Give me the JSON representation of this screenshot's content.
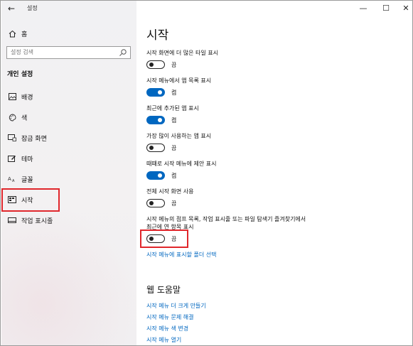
{
  "window": {
    "title": "설정",
    "controls": {
      "minimize": "—",
      "maximize": "☐",
      "close": "✕"
    }
  },
  "sidebar": {
    "home": "홈",
    "search_placeholder": "설정 검색",
    "section": "개인 설정",
    "items": [
      {
        "label": "배경",
        "icon": "image-icon"
      },
      {
        "label": "색",
        "icon": "palette-icon"
      },
      {
        "label": "잠금 화면",
        "icon": "lock-screen-icon"
      },
      {
        "label": "테마",
        "icon": "theme-icon"
      },
      {
        "label": "글꼴",
        "icon": "font-icon"
      },
      {
        "label": "시작",
        "icon": "start-icon",
        "selected": true
      },
      {
        "label": "작업 표시줄",
        "icon": "taskbar-icon"
      }
    ]
  },
  "main": {
    "title": "시작",
    "settings": [
      {
        "label": "시작 화면에 더 많은 타일 표시",
        "state": "off",
        "state_label": "끔"
      },
      {
        "label": "시작 메뉴에서 앱 목록 표시",
        "state": "on",
        "state_label": "켬"
      },
      {
        "label": "최근에 추가된 앱 표시",
        "state": "on",
        "state_label": "켬"
      },
      {
        "label": "가장 많이 사용하는 앱 표시",
        "state": "off",
        "state_label": "끔"
      },
      {
        "label": "때때로 시작 메뉴에 제안 표시",
        "state": "on",
        "state_label": "켬"
      },
      {
        "label": "전체 시작 화면 사용",
        "state": "off",
        "state_label": "끔"
      },
      {
        "label_line1": "시작 메뉴의 점프 목록, 작업 표시줄 또는 파일 탐색기 즐겨찾기에서",
        "label_line2": "최근에 연 항목 표시",
        "state": "off",
        "state_label": "끔"
      }
    ],
    "folders_link": "시작 메뉴에 표시할 폴더 선택",
    "help_title": "웹 도움말",
    "help_links": [
      "시작 메뉴 더 크게 만들기",
      "시작 메뉴 문제 해결",
      "시작 메뉴 색 변경",
      "시작 메뉴 열기"
    ]
  },
  "colors": {
    "accent": "#0067c0",
    "highlight": "#e0262b"
  }
}
